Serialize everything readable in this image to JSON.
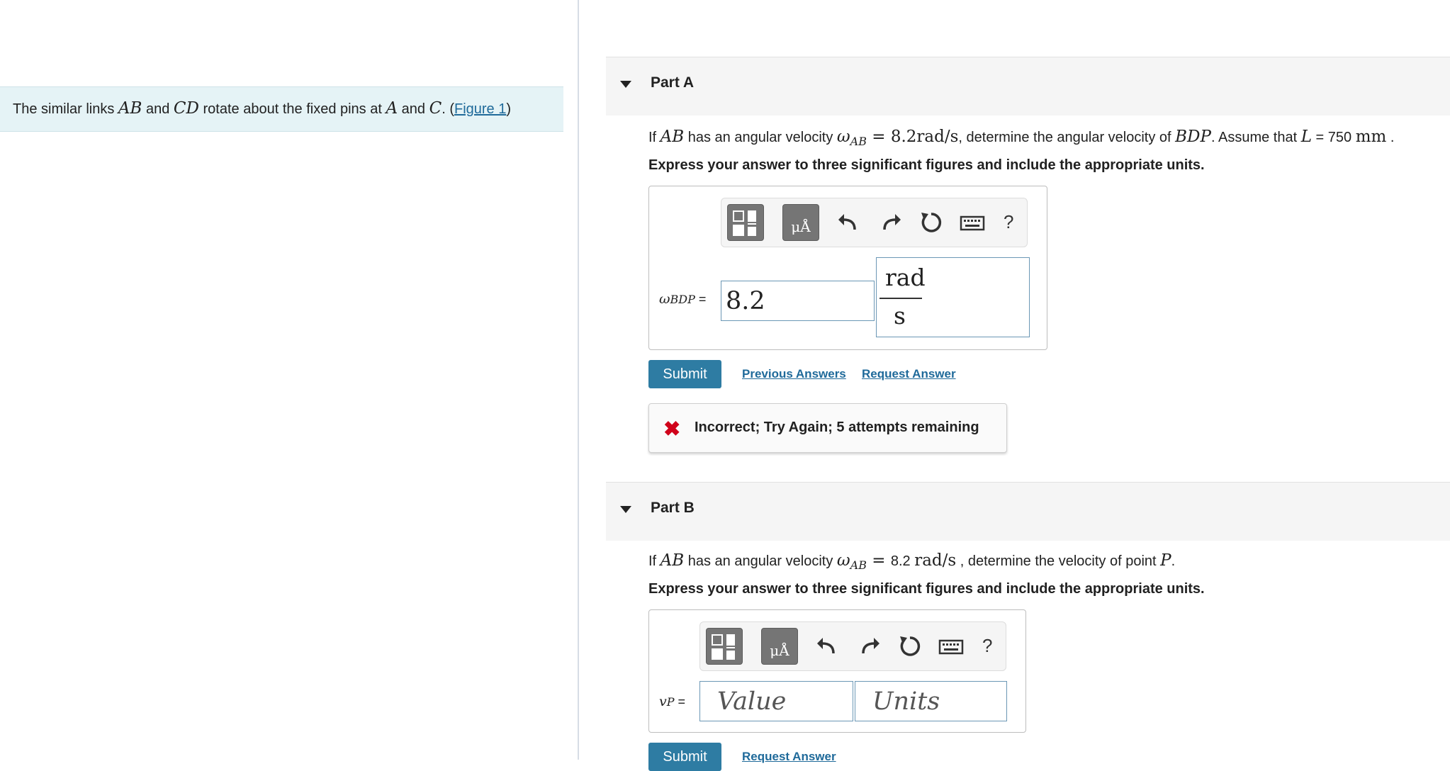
{
  "problem": {
    "text_1": "The similar links ",
    "ab": "AB",
    "text_2": " and ",
    "cd": "CD",
    "text_3": " rotate about the fixed pins at ",
    "a": "A",
    "text_4": " and ",
    "c": "C",
    "text_5": ". (",
    "figure_link": "Figure 1",
    "text_6": ")"
  },
  "part_a": {
    "title": "Part A",
    "q_if": "If ",
    "q_ab": "AB",
    "q_has": " has an angular velocity ",
    "q_omega": "ω",
    "q_sub": "AB",
    "q_eq": " = 8.2rad/s",
    "q_det": ", determine the angular velocity of ",
    "q_bdp": "BDP",
    "q_assume": ". Assume that ",
    "q_l": "L",
    "q_val": " = 750 ",
    "q_mm": "mm",
    "q_end": " .",
    "instruction": "Express your answer to three significant figures and include the appropriate units.",
    "var_omega": "ω",
    "var_sub": "BDP",
    "var_eq": " =",
    "value": "8.2",
    "unit_num": "rad",
    "unit_den": "s",
    "submit": "Submit",
    "previous_answers": "Previous Answers",
    "request_answer": "Request Answer",
    "feedback_icon": "✖",
    "feedback": "Incorrect; Try Again; 5 attempts remaining"
  },
  "part_b": {
    "title": "Part B",
    "q_if": "If ",
    "q_ab": "AB",
    "q_has": " has an angular velocity ",
    "q_omega": "ω",
    "q_sub": "AB",
    "q_eq": " = ",
    "q_val": "8.2 ",
    "q_unit": "rad/s",
    "q_det": " , determine the velocity of point ",
    "q_p": "P",
    "q_end": ".",
    "instruction": "Express your answer to three significant figures and include the appropriate units.",
    "var_v": "v",
    "var_sub": "P",
    "var_eq": " =",
    "value_placeholder": "Value",
    "units_placeholder": "Units",
    "submit": "Submit",
    "request_answer": "Request Answer"
  },
  "toolbar": {
    "templates_icon": "templates-icon",
    "units_label": "μÅ",
    "help": "?"
  },
  "colors": {
    "accent": "#2e7ca3",
    "link": "#1f6a9a",
    "error": "#d0021b",
    "problem_bg": "#e5f3f6"
  }
}
